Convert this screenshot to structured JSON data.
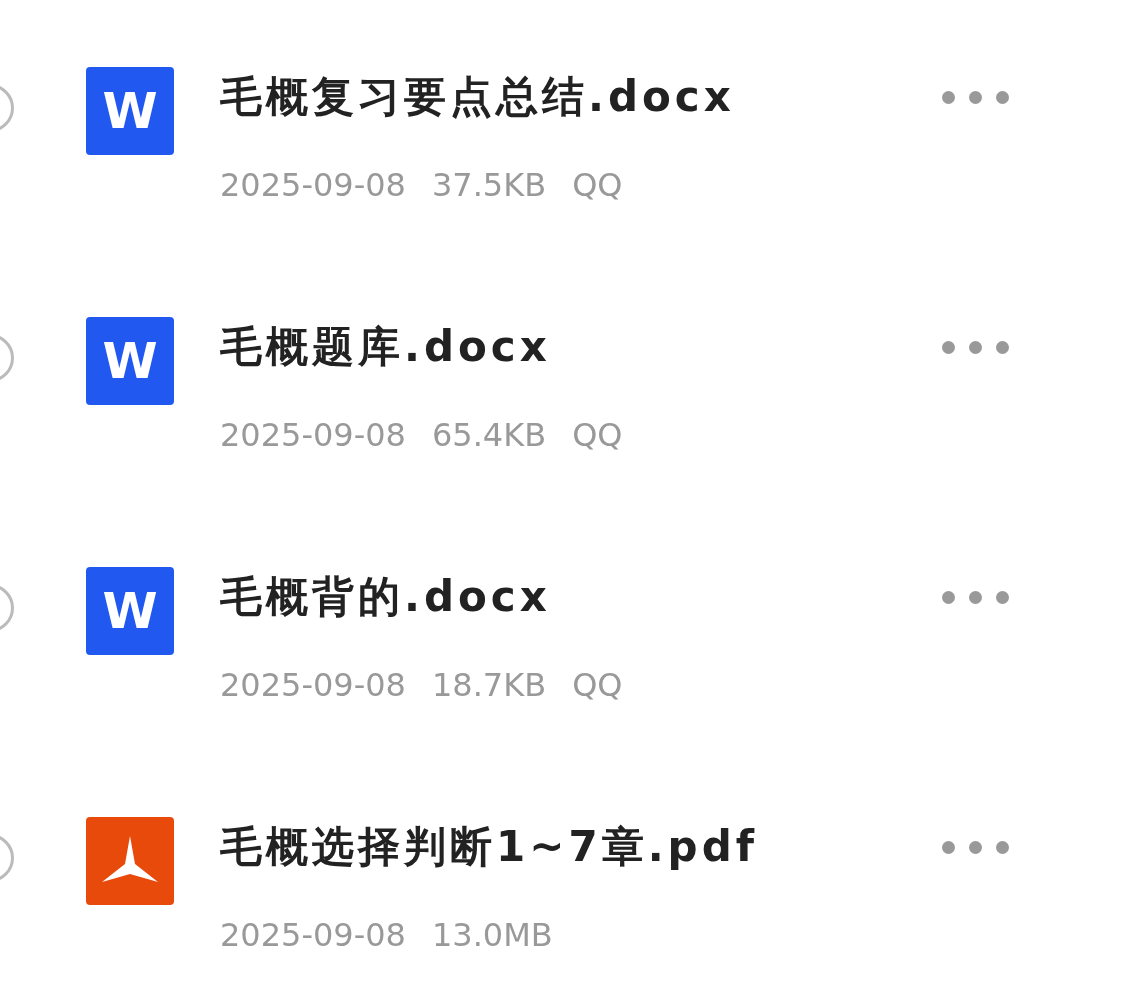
{
  "files": [
    {
      "name": "毛概复习要点总结.docx",
      "kind": "word",
      "icon_text": "W",
      "date": "2025-09-08",
      "size": "37.5KB",
      "source": "QQ",
      "checked": false
    },
    {
      "name": "毛概题库.docx",
      "kind": "word",
      "icon_text": "W",
      "date": "2025-09-08",
      "size": "65.4KB",
      "source": "QQ",
      "checked": false
    },
    {
      "name": "毛概背的.docx",
      "kind": "word",
      "icon_text": "W",
      "date": "2025-09-08",
      "size": "18.7KB",
      "source": "QQ",
      "checked": false
    },
    {
      "name": "毛概选择判断1~7章.pdf",
      "kind": "pdf",
      "date": "2025-09-08",
      "size": "13.0MB",
      "checked": false
    }
  ]
}
